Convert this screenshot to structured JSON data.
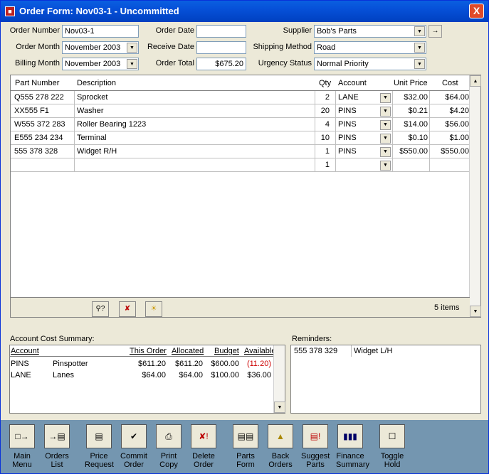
{
  "window": {
    "title": "Order Form: Nov03-1 - Uncommitted",
    "close": "X",
    "app_icon": "app-icon"
  },
  "header": {
    "order_number": {
      "label": "Order Number",
      "value": "Nov03-1"
    },
    "order_month": {
      "label": "Order Month",
      "value": "November 2003"
    },
    "billing_month": {
      "label": "Billing Month",
      "value": "November 2003"
    },
    "order_date": {
      "label": "Order Date",
      "value": ""
    },
    "receive_date": {
      "label": "Receive Date",
      "value": ""
    },
    "order_total": {
      "label": "Order Total",
      "value": "$675.20"
    },
    "supplier": {
      "label": "Supplier",
      "value": "Bob's Parts"
    },
    "shipping_method": {
      "label": "Shipping Method",
      "value": "Road"
    },
    "urgency_status": {
      "label": "Urgency Status",
      "value": "Normal Priority"
    }
  },
  "grid": {
    "columns": [
      "Part Number",
      "Description",
      "Qty",
      "Account",
      "Unit Price",
      "Cost"
    ],
    "rows": [
      {
        "part": "Q555 278 222",
        "desc": "Sprocket",
        "qty": "2",
        "account": "LANE",
        "unit": "$32.00",
        "cost": "$64.00"
      },
      {
        "part": "XX555 F1",
        "desc": "Washer",
        "qty": "20",
        "account": "PINS",
        "unit": "$0.21",
        "cost": "$4.20"
      },
      {
        "part": "W555 372 283",
        "desc": "Roller Bearing 1223",
        "qty": "4",
        "account": "PINS",
        "unit": "$14.00",
        "cost": "$56.00"
      },
      {
        "part": "E555 234 234",
        "desc": "Terminal",
        "qty": "10",
        "account": "PINS",
        "unit": "$0.10",
        "cost": "$1.00"
      },
      {
        "part": "555 378 328",
        "desc": "Widget R/H",
        "qty": "1",
        "account": "PINS",
        "unit": "$550.00",
        "cost": "$550.00"
      },
      {
        "part": "",
        "desc": "",
        "qty": "1",
        "account": "",
        "unit": "",
        "cost": ""
      }
    ],
    "item_count": "5 items"
  },
  "summary": {
    "title": "Account Cost Summary:",
    "columns": [
      "Account",
      "This Order",
      "Allocated",
      "Budget",
      "Available"
    ],
    "rows": [
      {
        "account": "PINS",
        "name": "Pinspotter",
        "this_order": "$611.20",
        "allocated": "$611.20",
        "budget": "$600.00",
        "available": "(11.20)"
      },
      {
        "account": "LANE",
        "name": "Lanes",
        "this_order": "$64.00",
        "allocated": "$64.00",
        "budget": "$100.00",
        "available": "$36.00"
      }
    ],
    "negative_color": "#cc0000"
  },
  "reminders": {
    "title": "Reminders:",
    "rows": [
      {
        "part": "555 378 329",
        "desc": "Widget L/H"
      }
    ]
  },
  "toolbar": {
    "buttons": [
      {
        "line1": "Main",
        "line2": "Menu",
        "icon": "exit-door-icon"
      },
      {
        "line1": "Orders",
        "line2": "List",
        "icon": "list-icon"
      },
      {
        "line1": "Price",
        "line2": "Request",
        "icon": "document-icon"
      },
      {
        "line1": "Commit",
        "line2": "Order",
        "icon": "commit-clipboard-icon"
      },
      {
        "line1": "Print",
        "line2": "Copy",
        "icon": "printer-icon"
      },
      {
        "line1": "Delete",
        "line2": "Order",
        "icon": "delete-icon"
      },
      {
        "line1": "Parts",
        "line2": "Form",
        "icon": "book-icon"
      },
      {
        "line1": "Back",
        "line2": "Orders",
        "icon": "folder-icon"
      },
      {
        "line1": "Suggest",
        "line2": "Parts",
        "icon": "suggest-icon"
      },
      {
        "line1": "Finance",
        "line2": "Summary",
        "icon": "bar-chart-icon"
      },
      {
        "line1": "Toggle",
        "line2": "Hold",
        "icon": "hold-icon"
      }
    ]
  },
  "colors": {
    "titlebar": "#0650d8",
    "toolbar_bg": "#7496b0",
    "window_bg": "#ece9d8"
  }
}
